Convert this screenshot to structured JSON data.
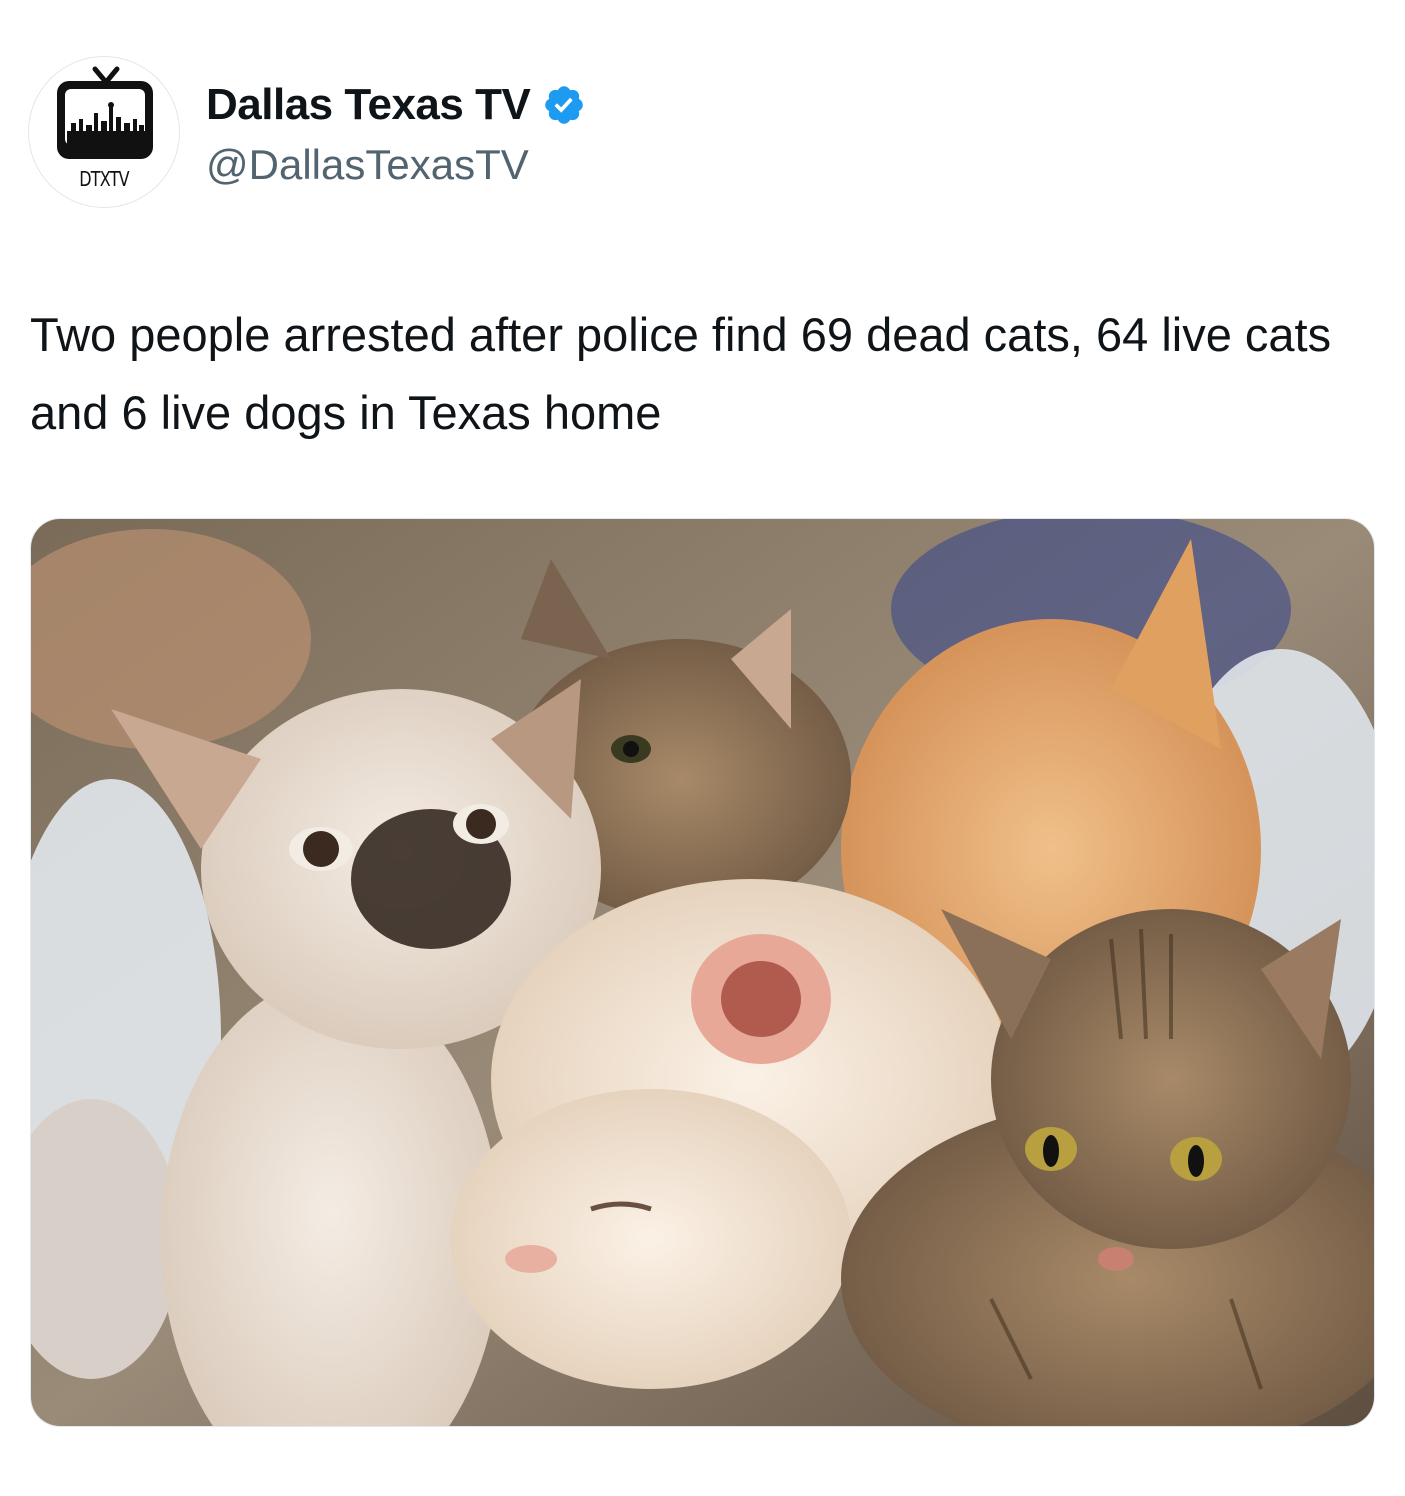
{
  "author": {
    "display_name": "Dallas Texas TV",
    "handle": "@DallasTexasTV",
    "verified": true,
    "avatar_text": "DTXTV",
    "verified_color": "#1d9bf0"
  },
  "tweet": {
    "text": "Two people arrested after police find 69 dead cats, 64 live cats and 6 live dogs in Texas home"
  },
  "media": {
    "subject": "photo-of-many-cats"
  },
  "colors": {
    "text_primary": "#0f1419",
    "text_secondary": "#536471",
    "background": "#ffffff"
  }
}
